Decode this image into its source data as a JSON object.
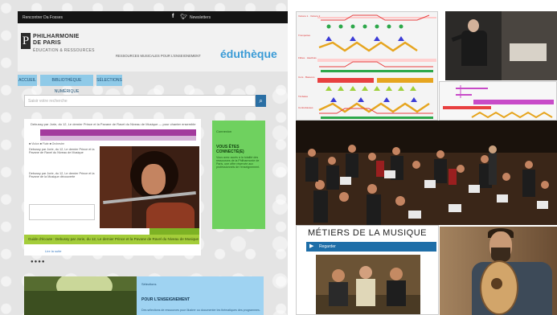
{
  "website": {
    "topbar": {
      "link_text": "Rencontrer Da Fosses",
      "newsletter": "Newsletters",
      "facebook_glyph": "f",
      "twitter_glyph": "•"
    },
    "logo": {
      "line1": "PHILHARMONIE",
      "line2": "DE PARIS",
      "line3": "ÉDUCATION & RESSOURCES",
      "mark": "P"
    },
    "tagline": "RESSOURCES MUSICALES POUR L'ENSEIGNEMENT",
    "partner_logo": "éduthèque",
    "nav": [
      "ACCUEIL",
      "BIBLIOTHÈQUE NUMÉRIQUE",
      "SÉLECTIONS"
    ],
    "search": {
      "placeholder": "Saisir votre recherche"
    },
    "feature_card": {
      "header": "Debussy par Jorie, du 12, Le dernier Prince et la Pavane de Ravel du Niveau de Musique — pour chanter ensemble",
      "legend": "■ Violon   ■ Flute   ■ Orchestre",
      "text1": "Debussy par Jorie, du 12, Le dernier Prince et la Pavane de Ravel du Niveau de Musique",
      "text2": "Debussy par Jorie, du 12, Le dernier Prince et la Pavane de la Musique découverte",
      "green_bar": "Guide d'écoute : Debussy par Jorie, du 12, Le dernier Prince et la Pavane de Ravel du Niveau de Musique",
      "read_more": "Lire la suite"
    },
    "carousel_dots": "●●●●",
    "sidebox": {
      "label": "Connexion",
      "heading": "VOUS ÊTES CONNECTÉ(E)",
      "text": "Vous avez accès à la totalité des ressources de la Philharmonie de Paris, une offre réservée aux professionnels de l'enseignement."
    },
    "blue_box": {
      "label": "Sélections",
      "heading": "POUR L'ENSEIGNEMENT",
      "text": "Des sélections de ressources pour illustrer ou documenter les thématiques des programmes."
    }
  },
  "score": {
    "rows": [
      {
        "label": "Violons 1 · Violons 2",
        "color": "#2da84a"
      },
      {
        "label": "Trompettes",
        "color": "#e6a51f"
      },
      {
        "label": "Flûtes · Hautbois",
        "color": "#e85252"
      },
      {
        "label": "Cors · Bassons",
        "color": "#c84bc8"
      },
      {
        "label": "Timbales",
        "color": "#2d8fd6"
      },
      {
        "label": "Contrebasses",
        "color": "#9fd03a"
      }
    ]
  },
  "metiers": {
    "title": "MÉTIERS DE LA MUSIQUE",
    "video_label": "Regarder"
  }
}
